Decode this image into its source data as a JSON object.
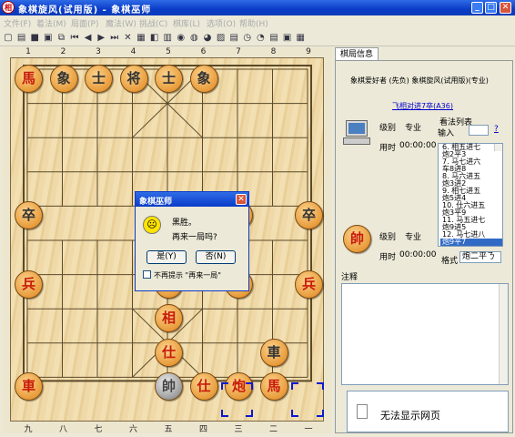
{
  "window": {
    "title": "象棋旋风(试用版) - 象棋巫师",
    "min": "_",
    "max": "□",
    "close": "✕"
  },
  "menu": [
    "文件(F)",
    "着法(M)",
    "局面(P)",
    "魔法(W)",
    "挑战(C)",
    "棋库(L)",
    "选项(O)",
    "帮助(H)"
  ],
  "toolbar_icons": [
    "new-icon",
    "open-icon",
    "save-icon",
    "print-icon",
    "copy-icon",
    "first-icon",
    "prev-icon",
    "next-icon",
    "last-icon",
    "delete-icon",
    "book-icon",
    "engine-icon",
    "analyze-icon",
    "color-icon",
    "sound-icon",
    "hint-icon",
    "board-icon",
    "clip-icon",
    "clock-icon",
    "timer-icon",
    "notation-icon",
    "image-icon",
    "settings-icon"
  ],
  "toolbar_glyphs": [
    "▢",
    "▤",
    "■",
    "▣",
    "⧉",
    "⏮",
    "◀",
    "▶",
    "⏭",
    "✕",
    "▦",
    "◧",
    "▥",
    "◉",
    "◍",
    "◕",
    "▨",
    "▤",
    "◷",
    "◔",
    "▤",
    "▣",
    "▦"
  ],
  "board": {
    "top_coords": [
      "1",
      "2",
      "3",
      "4",
      "5",
      "6",
      "7",
      "8",
      "9"
    ],
    "bottom_coords": [
      "九",
      "八",
      "七",
      "六",
      "五",
      "四",
      "三",
      "二",
      "一"
    ],
    "pieces": [
      {
        "ch": "馬",
        "side": "red"
      },
      {
        "ch": "象",
        "side": "black"
      },
      {
        "ch": "士",
        "side": "black"
      },
      {
        "ch": "将",
        "side": "black"
      },
      {
        "ch": "士",
        "side": "black"
      },
      {
        "ch": "象",
        "side": "black"
      },
      {
        "ch": "卒",
        "side": "black"
      },
      {
        "ch": "卒",
        "side": "black"
      },
      {
        "ch": "卒",
        "side": "black"
      },
      {
        "ch": "兵",
        "side": "red"
      },
      {
        "ch": "炮",
        "side": "red"
      },
      {
        "ch": "兵",
        "side": "red"
      },
      {
        "ch": "兵",
        "side": "red"
      },
      {
        "ch": "相",
        "side": "red"
      },
      {
        "ch": "仕",
        "side": "red"
      },
      {
        "ch": "車",
        "side": "black"
      },
      {
        "ch": "車",
        "side": "red"
      },
      {
        "ch": "帥",
        "side": "gray"
      },
      {
        "ch": "仕",
        "side": "red"
      },
      {
        "ch": "炮",
        "side": "red"
      },
      {
        "ch": "馬",
        "side": "red"
      }
    ]
  },
  "dialog": {
    "title": "象棋巫师",
    "line1": "黑胜。",
    "line2": "再来一局吗?",
    "yes": "是(Y)",
    "no": "否(N)",
    "checkbox": "不再提示 \"再来一局\"",
    "close": "✕"
  },
  "panel": {
    "tab": "棋局信息",
    "black_player": "象棋爱好者 (先负) 象棋旋风(试用版)(专业)",
    "opening_link": "飞相对进7卒(A36)",
    "black_level_label": "级别",
    "black_level": "专业",
    "black_time_label": "用时",
    "black_time": "00:00:00",
    "red_level_label": "级别",
    "red_level": "专业",
    "red_time_label": "用时",
    "red_time": "00:00:00",
    "movelist_label": "看法列表",
    "input_label": "输入",
    "help": "?",
    "moves": [
      "6. 相五进七",
      "炮2平3",
      "7. 马七进六",
      "车8进8",
      "8. 马六进五",
      "炮3进2",
      "9. 相七进五",
      "炮5进4",
      "10. 仕六进五",
      "炮3平9",
      "11. 马五进七",
      "炮9进5",
      "12. 马七进八",
      "炮9平7"
    ],
    "format_label": "格式",
    "format_value": "炮二平ㄋ",
    "notes_label": "注释",
    "web_text": "无法显示网页",
    "red_piece": "帥"
  }
}
